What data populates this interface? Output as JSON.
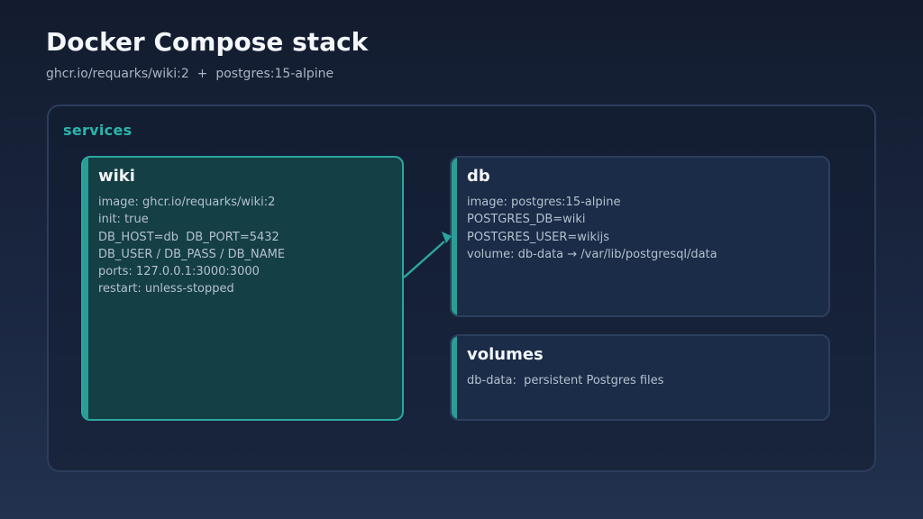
{
  "title": "Docker Compose stack",
  "subtitle": "ghcr.io/requarks/wiki:2  +  postgres:15-alpine",
  "panel_label": "services",
  "colors": {
    "accent": "#2bb5aa",
    "wiki_bg": "#143f45",
    "card_bg": "#1a2c47"
  },
  "wiki": {
    "title": "wiki",
    "lines": [
      "image: ghcr.io/requarks/wiki:2",
      "init: true",
      "DB_HOST=db  DB_PORT=5432",
      "DB_USER / DB_PASS / DB_NAME",
      "ports: 127.0.0.1:3000:3000",
      "restart: unless-stopped"
    ]
  },
  "db": {
    "title": "db",
    "lines": [
      "image: postgres:15-alpine",
      "POSTGRES_DB=wiki",
      "POSTGRES_USER=wikijs",
      "volume: db-data → /var/lib/postgresql/data"
    ]
  },
  "volumes": {
    "title": "volumes",
    "lines": [
      "db-data:  persistent Postgres files"
    ]
  }
}
